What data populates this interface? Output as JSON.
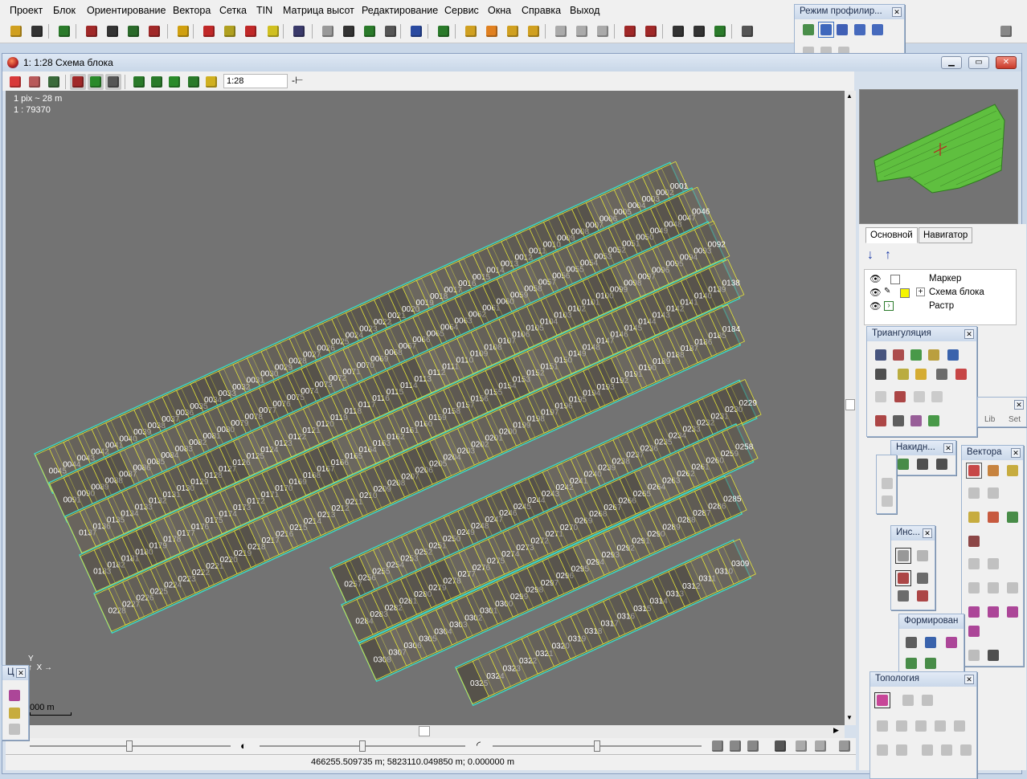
{
  "menu": [
    "Проект",
    "Блок",
    "Ориентирование",
    "Вектора",
    "Сетка",
    "TIN",
    "Матрица высот",
    "Редактирование",
    "Сервис",
    "Окна",
    "Справка",
    "Выход"
  ],
  "profile_window": {
    "title": "Режим профилир..."
  },
  "child_window": {
    "title": "1: 1:28 Схема блока",
    "scale_value": "1:28"
  },
  "canvas": {
    "pix_info": "1 pix ~ 28 m",
    "scale_info": "1 : 79370",
    "scalebar_label": "000 m"
  },
  "status": {
    "coords": "466255.509735 m; 5823110.049850 m; 0.000000 m"
  },
  "panel": {
    "tabs": [
      "Основной",
      "Навигатор"
    ],
    "layers": [
      {
        "name": "Маркер"
      },
      {
        "name": "Схема блока"
      },
      {
        "name": "Растр"
      }
    ]
  },
  "windows": {
    "triangulation": "Триангуляция",
    "nakid": "Накидн...",
    "vectors": "Вектора",
    "ins": "Инс...",
    "formir": "Формирован",
    "topology": "Топология",
    "c_small": "Ц",
    "lib_tabs": [
      "Lib",
      "Set"
    ]
  },
  "blocks": {
    "strip1": [
      "0001",
      "0002",
      "0003",
      "0004",
      "0005",
      "0006",
      "0007",
      "0008",
      "0009",
      "0010",
      "0011",
      "0012",
      "0013",
      "0014",
      "0015",
      "0016",
      "0017",
      "0018",
      "0019",
      "0020",
      "0021",
      "0022",
      "0023",
      "0024",
      "0025",
      "0026",
      "0027",
      "0028",
      "0029",
      "0030",
      "0031",
      "0032",
      "0033",
      "0034",
      "0035",
      "0036",
      "0037",
      "0038",
      "0039",
      "0040",
      "0041",
      "0042",
      "0043",
      "0044",
      "0045"
    ],
    "strip2": [
      "0091",
      "0090",
      "0089",
      "0088",
      "0087",
      "0086",
      "0085",
      "0084",
      "0083",
      "0082",
      "0081",
      "0080",
      "0079",
      "0078",
      "0077",
      "0076",
      "0075",
      "0074",
      "0073",
      "0072",
      "0071",
      "0070",
      "0069",
      "0068",
      "0067",
      "0066",
      "0065",
      "0064",
      "0063",
      "0062",
      "0061",
      "0060",
      "0059",
      "0058",
      "0057",
      "0056",
      "0055",
      "0054",
      "0053",
      "0052",
      "0051",
      "0050",
      "0049",
      "0048",
      "0047",
      "0046"
    ],
    "strip3": [
      "0092",
      "0093",
      "0094",
      "0095",
      "0096",
      "0097",
      "0098",
      "0099",
      "0100",
      "0101",
      "0102",
      "0103",
      "0104",
      "0105",
      "0106",
      "0107",
      "0108",
      "0109",
      "0110",
      "0111",
      "0112",
      "0113",
      "0114",
      "0115",
      "0116",
      "0117",
      "0118",
      "0119",
      "0120",
      "0121",
      "0122",
      "0123",
      "0124",
      "0125",
      "0126",
      "0127",
      "0128",
      "0129",
      "0130",
      "0131",
      "0132",
      "0133",
      "0134",
      "0135",
      "0136",
      "0137"
    ],
    "strip4": [
      "0183",
      "0182",
      "0181",
      "0180",
      "0179",
      "0178",
      "0177",
      "0176",
      "0175",
      "0174",
      "0173",
      "0172",
      "0171",
      "0170",
      "0169",
      "0168",
      "0167",
      "0166",
      "0165",
      "0164",
      "0163",
      "0162",
      "0161",
      "0160",
      "0159",
      "0158",
      "0157",
      "0156",
      "0155",
      "0154",
      "0153",
      "0152",
      "0151",
      "0150",
      "0149",
      "0148",
      "0147",
      "0146",
      "0145",
      "0144",
      "0143",
      "0142",
      "0141",
      "0140",
      "0139",
      "0138"
    ],
    "strip5": [
      "0184",
      "0185",
      "0186",
      "0187",
      "0188",
      "0189",
      "0190",
      "0191",
      "0192",
      "0193",
      "0194",
      "0195",
      "0196",
      "0197",
      "0198",
      "0199",
      "0200",
      "0201",
      "0202",
      "0203",
      "0204",
      "0205",
      "0206",
      "0207",
      "0208",
      "0209",
      "0210",
      "0211",
      "0212",
      "0213",
      "0214",
      "0215",
      "0216",
      "0217",
      "0218",
      "0219",
      "0220",
      "0221",
      "0222",
      "0223",
      "0224",
      "0225",
      "0226",
      "0227",
      "0228"
    ],
    "strip6": [
      "0257",
      "0256",
      "0255",
      "0254",
      "0253",
      "0252",
      "0251",
      "0250",
      "0249",
      "0248",
      "0247",
      "0246",
      "0245",
      "0244",
      "0243",
      "0242",
      "0241",
      "0240",
      "0239",
      "0238",
      "0237",
      "0236",
      "0235",
      "0234",
      "0233",
      "0232",
      "0231",
      "0230",
      "0229"
    ],
    "strip7": [
      "0258",
      "0259",
      "0260",
      "0261",
      "0262",
      "0263",
      "0264",
      "0265",
      "0266",
      "0267",
      "0268",
      "0269",
      "0270",
      "0271",
      "0272",
      "0273",
      "0274",
      "0275",
      "0276",
      "0277",
      "0278",
      "0279",
      "0280",
      "0281",
      "0282",
      "0283",
      "0284"
    ],
    "strip8": [
      "0308",
      "0307",
      "0306",
      "0305",
      "0304",
      "0303",
      "0302",
      "0301",
      "0300",
      "0299",
      "0298",
      "0297",
      "0296",
      "0295",
      "0294",
      "0293",
      "0292",
      "0291",
      "0290",
      "0289",
      "0288",
      "0287",
      "0286",
      "0285"
    ],
    "strip9": [
      "0309",
      "0310",
      "0311",
      "0312",
      "0313",
      "0314",
      "0315",
      "0316",
      "0317",
      "0318",
      "0319",
      "0320",
      "0321",
      "0322",
      "0323",
      "0324",
      "0325"
    ]
  },
  "colors": {
    "footprint": "#e5e539",
    "strip_border": "#3fd6c4",
    "canvas_bg": "#737373",
    "overview_block": "#5fbf3f"
  }
}
